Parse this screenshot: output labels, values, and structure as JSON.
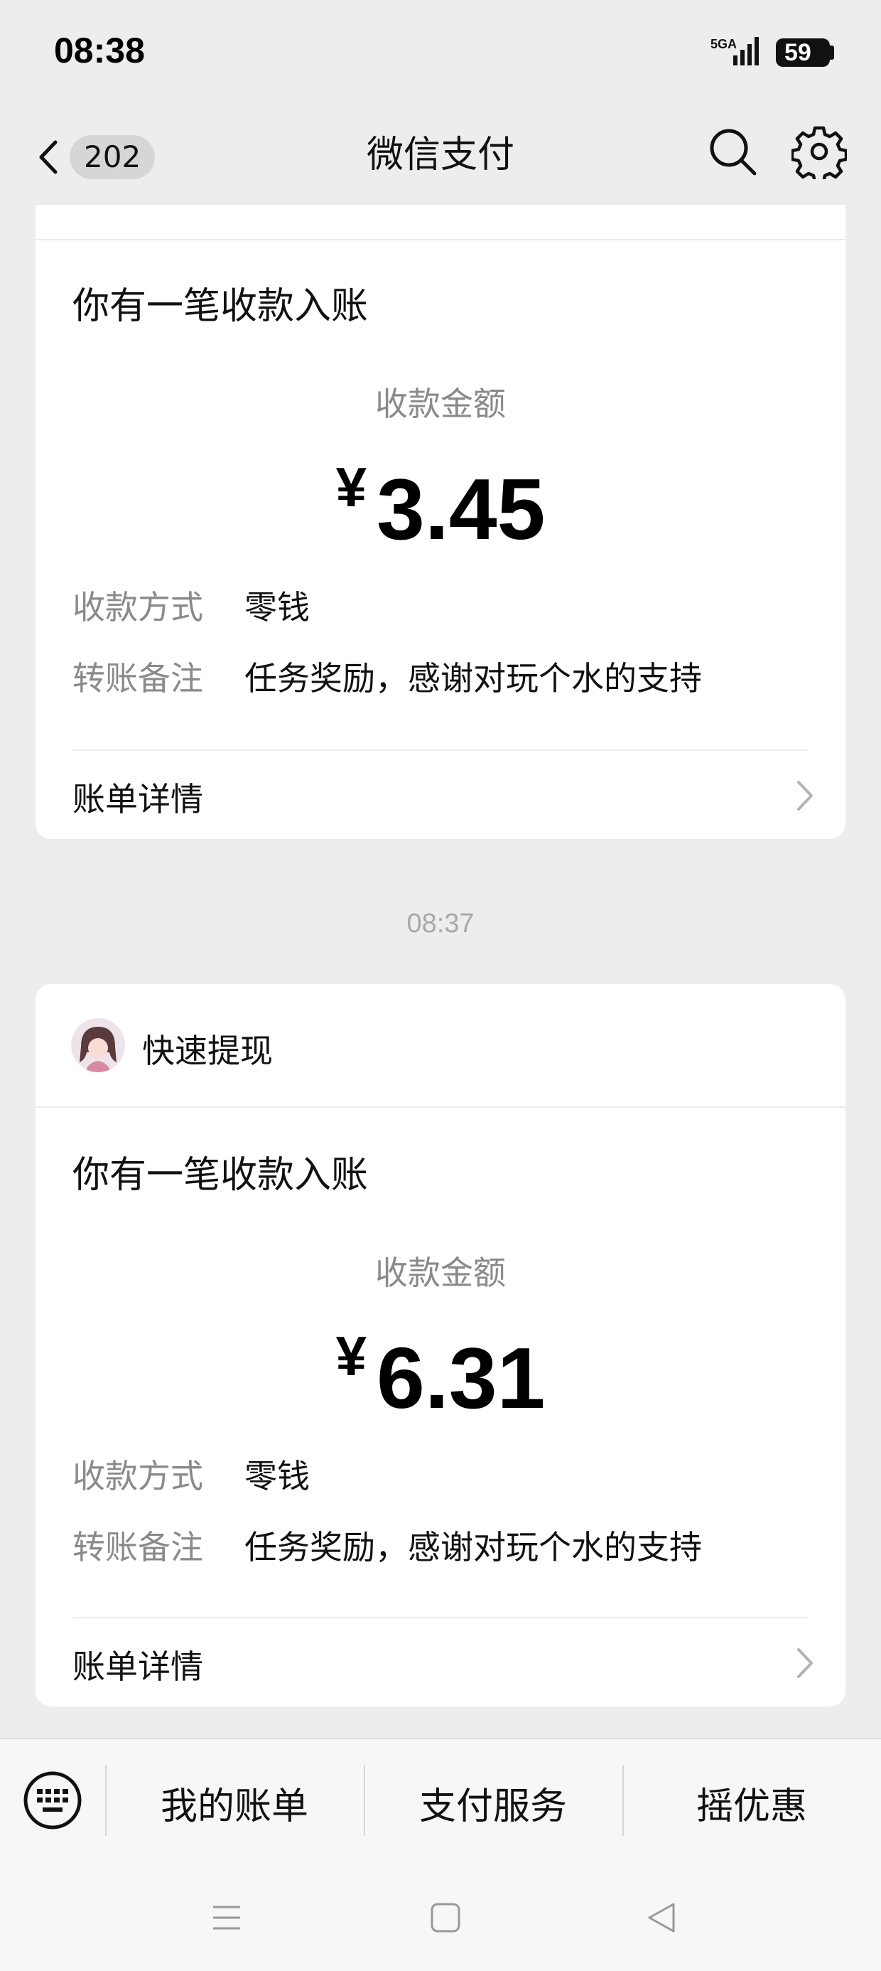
{
  "status_bar": {
    "time": "08:38",
    "network": "5GA",
    "battery": "59"
  },
  "nav": {
    "unread_count": "202",
    "title": "微信支付"
  },
  "cards": [
    {
      "title": "你有一笔收款入账",
      "amount_caption": "收款金额",
      "currency": "¥",
      "amount": "3.45",
      "method_label": "收款方式",
      "method_value": "零钱",
      "note_label": "转账备注",
      "note_value": "任务奖励，感谢对玩个水的支持",
      "detail_link": "账单详情"
    },
    {
      "app_name": "快速提现",
      "title": "你有一笔收款入账",
      "amount_caption": "收款金额",
      "currency": "¥",
      "amount": "6.31",
      "method_label": "收款方式",
      "method_value": "零钱",
      "note_label": "转账备注",
      "note_value": "任务奖励，感谢对玩个水的支持",
      "detail_link": "账单详情"
    }
  ],
  "timestamp": "08:37",
  "bottom_menu": {
    "items": [
      "我的账单",
      "支付服务",
      "摇优惠"
    ]
  },
  "icons": [
    "back-icon",
    "search-icon",
    "gear-icon",
    "keyboard-icon",
    "chevron-right-icon",
    "menu-icon",
    "home-icon",
    "back-triangle-icon"
  ]
}
